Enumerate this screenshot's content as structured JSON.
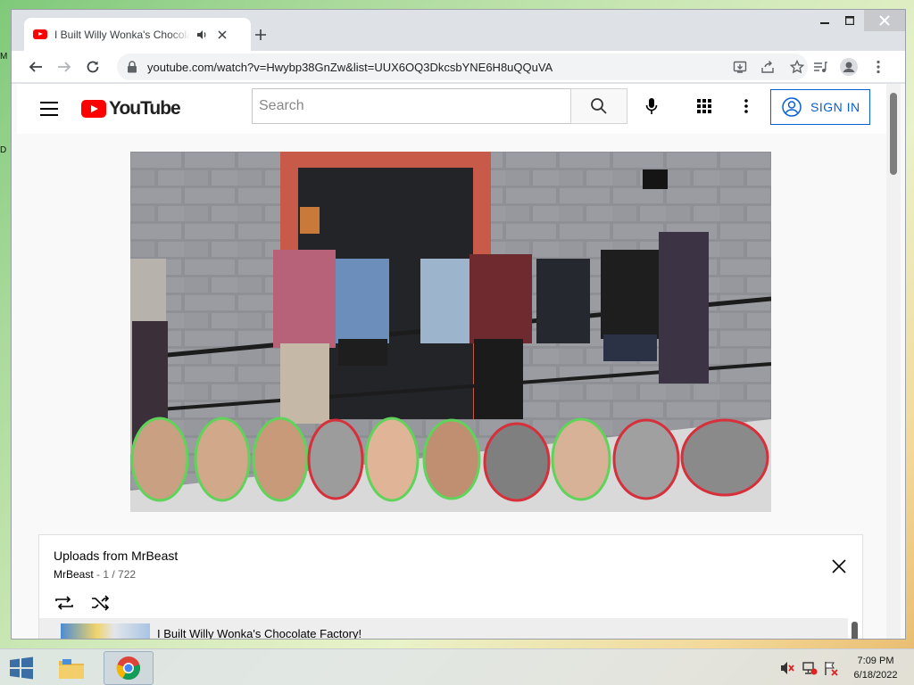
{
  "desktop": {
    "edge_text_1": "M",
    "edge_text_2": "D"
  },
  "browser": {
    "tab_title": "I Built Willy Wonka's Chocolate Factory!",
    "url": "youtube.com/watch?v=Hwybp38GnZw&list=UUX6OQ3DkcsbYNE6H8uQQuVA"
  },
  "youtube": {
    "logo_text": "YouTube",
    "search_placeholder": "Search",
    "sign_in_label": "SIGN IN"
  },
  "playlist": {
    "title": "Uploads from MrBeast",
    "owner": "MrBeast",
    "position": " - 1 / 722",
    "items": [
      {
        "title": "I Built Willy Wonka's Chocolate Factory!"
      }
    ]
  },
  "taskbar": {
    "time": "7:09 PM",
    "date": "6/18/2022"
  },
  "colors": {
    "youtube_red": "#ff0000",
    "sign_in_blue": "#065fd4",
    "face_ring_green": "#5fd35a",
    "face_ring_red": "#d6303a"
  }
}
